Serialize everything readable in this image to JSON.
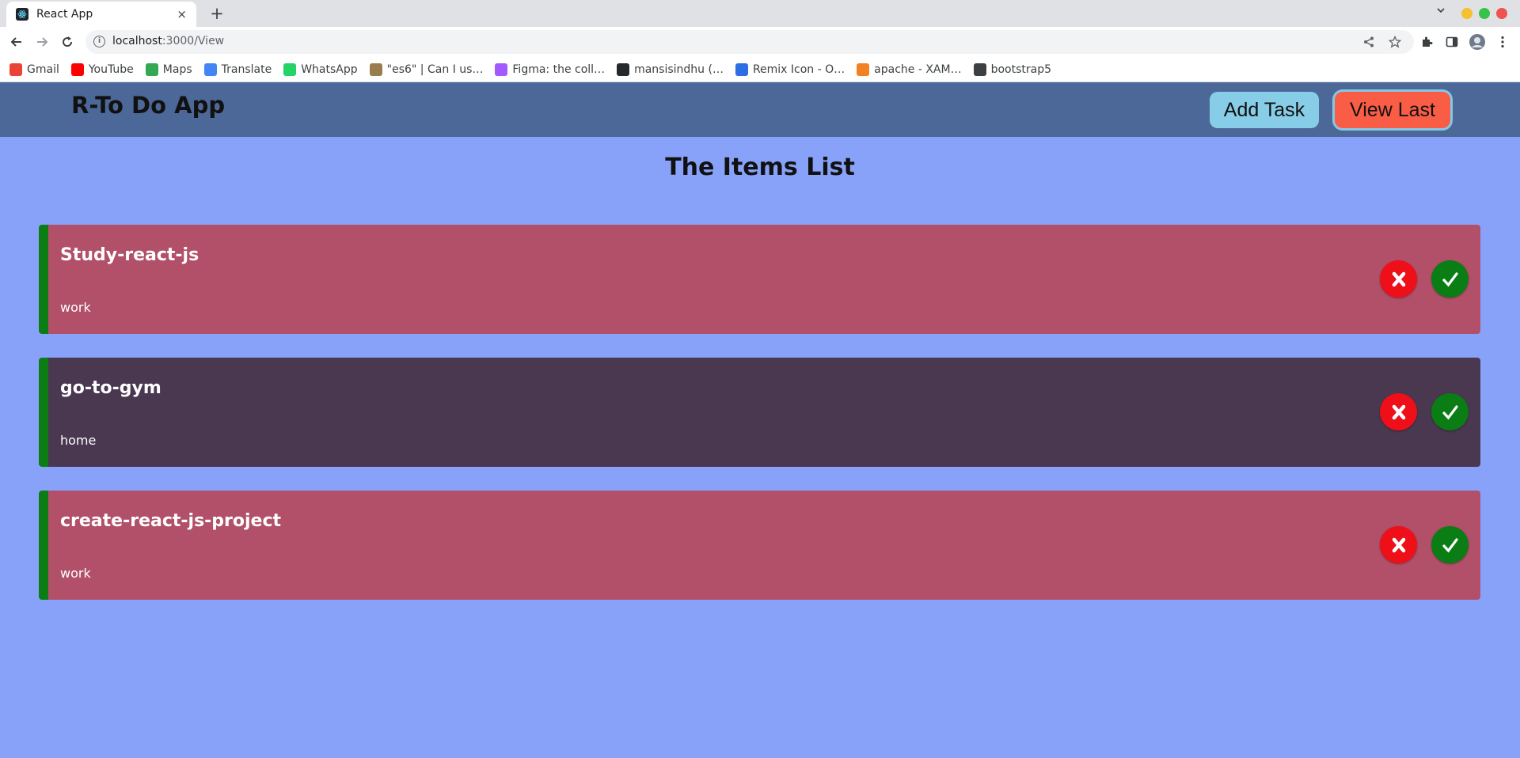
{
  "browser": {
    "tab_title": "React App",
    "tab_close": "×",
    "new_tab": "+",
    "url_host": "localhost",
    "url_path": ":3000/View",
    "bookmarks": [
      {
        "label": "Gmail",
        "icon": "gmail-icon",
        "color": "#ea4335"
      },
      {
        "label": "YouTube",
        "icon": "youtube-icon",
        "color": "#ff0000"
      },
      {
        "label": "Maps",
        "icon": "maps-icon",
        "color": "#34a853"
      },
      {
        "label": "Translate",
        "icon": "translate-icon",
        "color": "#4285f4"
      },
      {
        "label": "WhatsApp",
        "icon": "whatsapp-icon",
        "color": "#25d366"
      },
      {
        "label": "\"es6\" | Can I us…",
        "icon": "caniuse-icon",
        "color": "#9a7d4f"
      },
      {
        "label": "Figma: the coll…",
        "icon": "figma-icon",
        "color": "#a259ff"
      },
      {
        "label": "mansisindhu (…",
        "icon": "github-icon",
        "color": "#24292e"
      },
      {
        "label": "Remix Icon - O…",
        "icon": "remix-icon",
        "color": "#2b6fe3"
      },
      {
        "label": "apache - XAM…",
        "icon": "stackoverflow-icon",
        "color": "#f48024"
      },
      {
        "label": "bootstrap5",
        "icon": "folder-icon",
        "color": "#3c4043"
      }
    ]
  },
  "app": {
    "brand": "R-To Do App",
    "add_task_label": "Add Task",
    "view_last_label": "View Last",
    "list_title": "The Items List",
    "delete_symbol": "✘",
    "done_symbol": "✓",
    "items": [
      {
        "title": "Study-react-js",
        "tag": "work",
        "color": "#b15068"
      },
      {
        "title": "go-to-gym",
        "tag": "home",
        "color": "#4a3750"
      },
      {
        "title": "create-react-js-project",
        "tag": "work",
        "color": "#b15068"
      }
    ]
  },
  "colors": {
    "page_bg": "#88a2fa",
    "header_bg": "#4c6898",
    "accent_green": "#0b7d14",
    "delete_red": "#ee0f18"
  }
}
